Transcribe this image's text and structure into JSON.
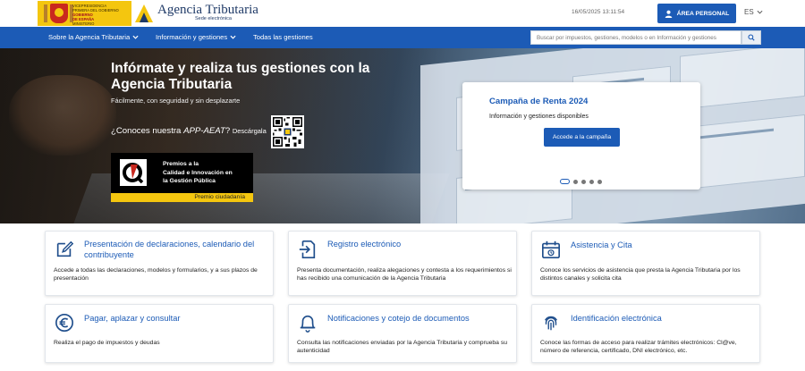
{
  "header": {
    "gov_logo_lines": [
      "VICEPRESIDENCIA",
      "PRIMERA DEL GOBIERNO",
      "MINISTERIO",
      "DE HACIENDA"
    ],
    "gov_logo_red_lines": [
      "GOBIERNO",
      "DE ESPAÑA"
    ],
    "agency_name": "Agencia Tributaria",
    "agency_sub": "Sede electrónica",
    "datetime": "16/05/2025 13:11:54",
    "area_button": "ÁREA PERSONAL",
    "language": "ES"
  },
  "nav": {
    "items": [
      {
        "label": "Sobre la Agencia Tributaria",
        "has_dropdown": true
      },
      {
        "label": "Información y gestiones",
        "has_dropdown": true
      },
      {
        "label": "Todas las gestiones",
        "has_dropdown": false
      }
    ],
    "search_placeholder": "Buscar por impuestos, gestiones, modelos o en Información y gestiones"
  },
  "hero": {
    "title": "Infórmate y realiza tus gestiones con la Agencia Tributaria",
    "subtitle": "Fácilmente, con seguridad y sin desplazarte",
    "app_prefix": "¿Conoces nuestra ",
    "app_name": "APP-AEAT",
    "app_suffix": "? ",
    "app_download": "Descárgala",
    "award_lines": [
      "Premios a la",
      "Calidad e Innovación en",
      "la Gestión Pública"
    ],
    "award_strip": "Premio ciudadanía"
  },
  "campaign": {
    "title": "Campaña de Renta 2024",
    "text": "Información y gestiones disponibles",
    "button": "Accede a la campaña",
    "slides_total": 5,
    "active_slide": 1
  },
  "cards": [
    {
      "icon": "edit-form-icon",
      "title": "Presentación de declaraciones, calendario del contribuyente",
      "desc": "Accede a todas las declaraciones, modelos y formularios, y a sus plazos de presentación"
    },
    {
      "icon": "document-arrow-icon",
      "title": "Registro electrónico",
      "desc": "Presenta documentación, realiza alegaciones y contesta a los requerimientos si has recibido una comunicación de la Agencia Tributaria"
    },
    {
      "icon": "calendar-icon",
      "title": "Asistencia y Cita",
      "desc": "Conoce los servicios de asistencia que presta la Agencia Tributaria por los distintos canales y solicita cita"
    },
    {
      "icon": "euro-icon",
      "title": "Pagar, aplazar y consultar",
      "desc": "Realiza el pago de impuestos y deudas"
    },
    {
      "icon": "bell-icon",
      "title": "Notificaciones y cotejo de documentos",
      "desc": "Consulta las notificaciones enviadas por la Agencia Tributaria y comprueba su autenticidad"
    },
    {
      "icon": "fingerprint-icon",
      "title": "Identificación electrónica",
      "desc": "Conoce las formas de acceso para realizar trámites electrónicos: Cl@ve, número de referencia, certificado, DNI electrónico, etc."
    }
  ],
  "colors": {
    "primary": "#1c5bb6",
    "gov_yellow": "#f4c60f",
    "gov_red": "#c9281e"
  }
}
